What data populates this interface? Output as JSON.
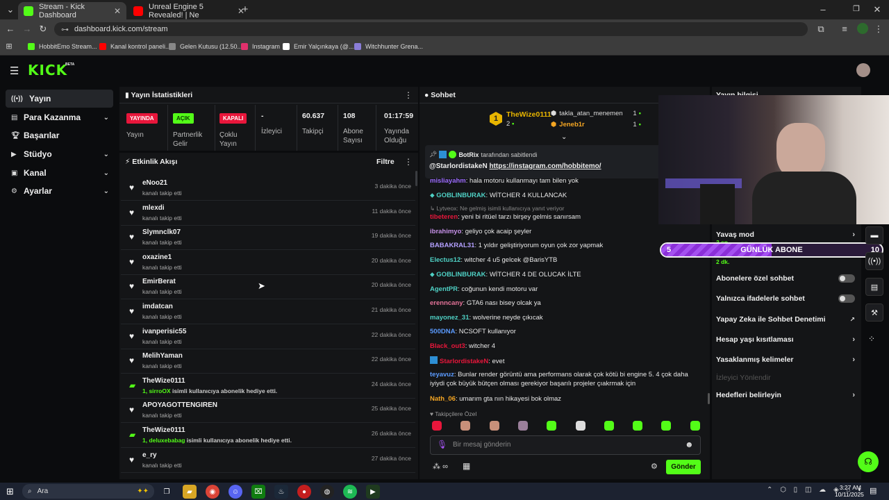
{
  "browser": {
    "tabs": [
      {
        "title": "Stream - Kick Dashboard",
        "active": true,
        "favicon_color": "#53fc18"
      },
      {
        "title": "Unreal Engine 5 Revealed! | Ne",
        "active": false,
        "favicon_color": "#ff0000"
      }
    ],
    "new_tab": "+",
    "url": "dashboard.kick.com/stream",
    "bookmarks": [
      {
        "label": "HobbitEmo Stream...",
        "color": "#53fc18"
      },
      {
        "label": "Kanal kontrol paneli...",
        "color": "#ff0000"
      },
      {
        "label": "Gelen Kutusu (12.50...",
        "color": "#888888"
      },
      {
        "label": "Instagram",
        "color": "#e1306c"
      },
      {
        "label": "Emir Yalçınkaya (@...",
        "color": "#ffffff"
      },
      {
        "label": "Witchhunter Grena...",
        "color": "#8a7dd8"
      }
    ]
  },
  "header": {
    "logo": "KICK",
    "beta": "BETA"
  },
  "sidebar": {
    "items": [
      {
        "label": "Yayın",
        "icon": "broadcast-icon",
        "selected": true,
        "chevron": false
      },
      {
        "label": "Para Kazanma",
        "icon": "money-icon",
        "selected": false,
        "chevron": true
      },
      {
        "label": "Başarılar",
        "icon": "trophy-icon",
        "selected": false,
        "chevron": false
      },
      {
        "label": "Stüdyo",
        "icon": "video-icon",
        "selected": false,
        "chevron": true
      },
      {
        "label": "Kanal",
        "icon": "channel-icon",
        "selected": false,
        "chevron": true
      },
      {
        "label": "Ayarlar",
        "icon": "gear-icon",
        "selected": false,
        "chevron": true
      }
    ]
  },
  "stats": {
    "title": "Yayın İstatistikleri",
    "cells": [
      {
        "badge": "YAYINDA",
        "badge_bg": "#e8163b",
        "label": "Yayın"
      },
      {
        "badge": "AÇIK",
        "badge_bg": "#53fc18",
        "label": "Partnerlik Gelir"
      },
      {
        "badge": "KAPALI",
        "badge_bg": "#e8163b",
        "label": "Çoklu Yayın"
      },
      {
        "value": "-",
        "label": "İzleyici"
      },
      {
        "value": "60.637",
        "label": "Takipçi"
      },
      {
        "value": "108",
        "label": "Abone Sayısı"
      },
      {
        "value": "01:17:59",
        "label": "Yayında Olduğu Süre"
      }
    ]
  },
  "feed": {
    "title": "Etkinlik Akışı",
    "filter": "Filtre",
    "rows": [
      {
        "name": "eNoo21",
        "sub": "kanalı takip etti",
        "time": "3 dakika önce",
        "type": "follow"
      },
      {
        "name": "mlexdi",
        "sub": "kanalı takip etti",
        "time": "11 dakika önce",
        "type": "follow"
      },
      {
        "name": "Slymnclk07",
        "sub": "kanalı takip etti",
        "time": "19 dakika önce",
        "type": "follow"
      },
      {
        "name": "oxazine1",
        "sub": "kanalı takip etti",
        "time": "20 dakika önce",
        "type": "follow"
      },
      {
        "name": "EmirBerat",
        "sub": "kanalı takip etti",
        "time": "20 dakika önce",
        "type": "follow"
      },
      {
        "name": "imdatcan",
        "sub": "kanalı takip etti",
        "time": "21 dakika önce",
        "type": "follow"
      },
      {
        "name": "ivanperisic55",
        "sub": "kanalı takip etti",
        "time": "22 dakika önce",
        "type": "follow"
      },
      {
        "name": "MelihYaman",
        "sub": "kanalı takip etti",
        "time": "22 dakika önce",
        "type": "follow"
      },
      {
        "name": "TheWize0111",
        "sub_hl": "1, sirroOX",
        "sub": " isimli kullanıcıya abonelik hediye etti.",
        "time": "24 dakika önce",
        "type": "gift"
      },
      {
        "name": "APOYAGOTTENGIREN",
        "sub": "kanalı takip etti",
        "time": "25 dakika önce",
        "type": "follow"
      },
      {
        "name": "TheWize0111",
        "sub_hl": "1, deluxebabag",
        "sub": " isimli kullanıcıya abonelik hediye etti.",
        "time": "26 dakika önce",
        "type": "gift"
      },
      {
        "name": "e_ry",
        "sub": "kanalı takip etti",
        "time": "27 dakika önce",
        "type": "follow"
      }
    ]
  },
  "chat": {
    "title": "Sohbet",
    "leaderboard": {
      "top": {
        "rank": "1",
        "name": "TheWize0111",
        "count": "2"
      },
      "others": [
        {
          "name": "takla_atan_menemen",
          "count": "1"
        },
        {
          "name": "Jeneb1r",
          "count": "1"
        }
      ]
    },
    "pinned": {
      "by": "BotRix",
      "by_suffix": "tarafından sabitlendi",
      "user": "@StarlordistakeN",
      "link": "https://instagram.com/hobbitemo/"
    },
    "messages": [
      {
        "user": "misliayahm",
        "color": "#9c6bff",
        "text": "hala motoru kullanmayı tam bilen yok"
      },
      {
        "user": "GOBLINBURAK",
        "color": "#4fd1c5",
        "text": "WİTCHER 4 KULLANCAK"
      },
      {
        "reply": "Lytveox: Ne gelmiş isimli kullanıcıya yanıt veriyor"
      },
      {
        "user": "tibeteren",
        "color": "#e8163b",
        "text": "yeni bi ritüel tarzı birşey gelmis sanırsam"
      },
      {
        "user": "ibrahimyo",
        "color": "#c792ea",
        "text": "geliyo çok acaip şeyler"
      },
      {
        "user": "BABAKRAL31",
        "color": "#b4a0ff",
        "text": "1 yıldır geliştiriyorum oyun çok zor yapmak"
      },
      {
        "user": "Electus12",
        "color": "#4fd1c5",
        "text": "witcher 4 u5 gelcek @BarisYTB"
      },
      {
        "user": "GOBLINBURAK",
        "color": "#4fd1c5",
        "text": "WİTCHER 4 DE OLUCAK İLTE"
      },
      {
        "user": "AgentPR",
        "color": "#4fd1c5",
        "text": "coğunun kendi motoru var"
      },
      {
        "user": "erenncany",
        "color": "#e57399",
        "text": "GTA6 nası bisey olcak ya"
      },
      {
        "user": "mayonez_31",
        "color": "#4fd1c5",
        "text": "wolverine neyde çıkıcak"
      },
      {
        "user": "500DNA",
        "color": "#5b9bff",
        "text": "NCSOFT kullanıyor"
      },
      {
        "user": "Black_out3",
        "color": "#e8163b",
        "text": "witcher 4"
      },
      {
        "user": "StarlordistakeN",
        "color": "#e8163b",
        "text": "evet"
      },
      {
        "user": "teyavuz",
        "color": "#5b9bff",
        "text": "Bunlar render görüntü ama performans olarak çok kötü bi engine 5. 4 çok daha iyiydi çok büyük bütçen olması gerekiyor başarılı projeler çıakrmak için"
      },
      {
        "user": "Nath_06",
        "color": "#f5a623",
        "text": "umarım gta nın hikayesi bok olmaz"
      }
    ],
    "emote_label": "Takipçilere Özel",
    "input_placeholder": "Bir mesaj gönderin",
    "send_label": "Gönder",
    "points_label": "∞"
  },
  "info_panel": {
    "title": "Yayın bilgisi",
    "rows": [
      {
        "label": "Yavaş mod",
        "sub": "3 sn",
        "control": "chevron"
      },
      {
        "label": "Sohbet",
        "sub": "2 dk.",
        "control": "chevron"
      },
      {
        "label": "Abonelere özel sohbet",
        "control": "toggle"
      },
      {
        "label": "Yalnızca ifadelerle sohbet",
        "control": "toggle"
      },
      {
        "label": "Yapay Zeka ile Sohbet Denetimi",
        "control": "external"
      },
      {
        "label": "Hesap yaşı kısıtlaması",
        "control": "chevron"
      },
      {
        "label": "Yasaklanmış kelimeler",
        "control": "chevron"
      },
      {
        "label": "İzleyici Yönlendir",
        "control": "none",
        "disabled": true
      },
      {
        "label": "Hedefleri belirleyin",
        "control": "chevron"
      }
    ]
  },
  "overlay": {
    "goal_left": "5",
    "goal_label": "GÜNLÜK ABONE",
    "goal_right": "10",
    "goal_progress": 0.5
  },
  "taskbar": {
    "search": "Ara",
    "time": "3:27 AM",
    "date": "10/11/2025"
  }
}
